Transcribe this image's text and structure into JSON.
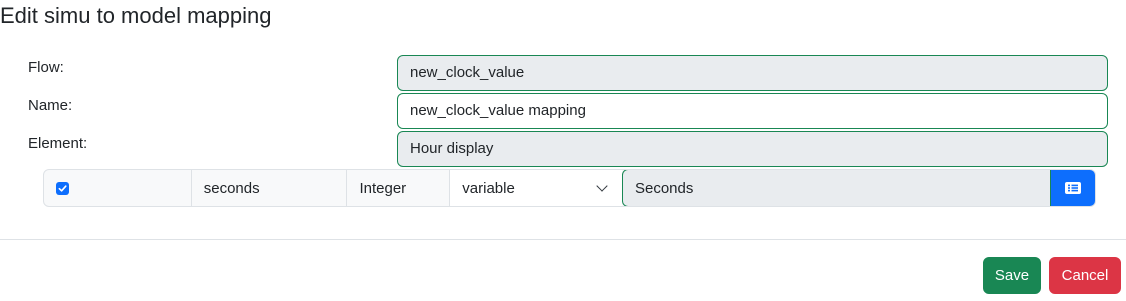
{
  "dialog": {
    "title": "Edit simu to model mapping"
  },
  "form": {
    "flow_label": "Flow:",
    "flow_value": "new_clock_value",
    "name_label": "Name:",
    "name_value": "new_clock_value mapping",
    "element_label": "Element:",
    "element_value": "Hour display"
  },
  "mapping_row": {
    "checked": true,
    "name": "seconds",
    "type": "Integer",
    "kind_selected": "variable",
    "target_value": "Seconds",
    "list_button_icon": "list-icon"
  },
  "footer": {
    "save_label": "Save",
    "cancel_label": "Cancel"
  },
  "colors": {
    "success": "#198754",
    "danger": "#dc3545",
    "primary": "#0d6efd",
    "readonly_bg": "#e9ecef"
  }
}
